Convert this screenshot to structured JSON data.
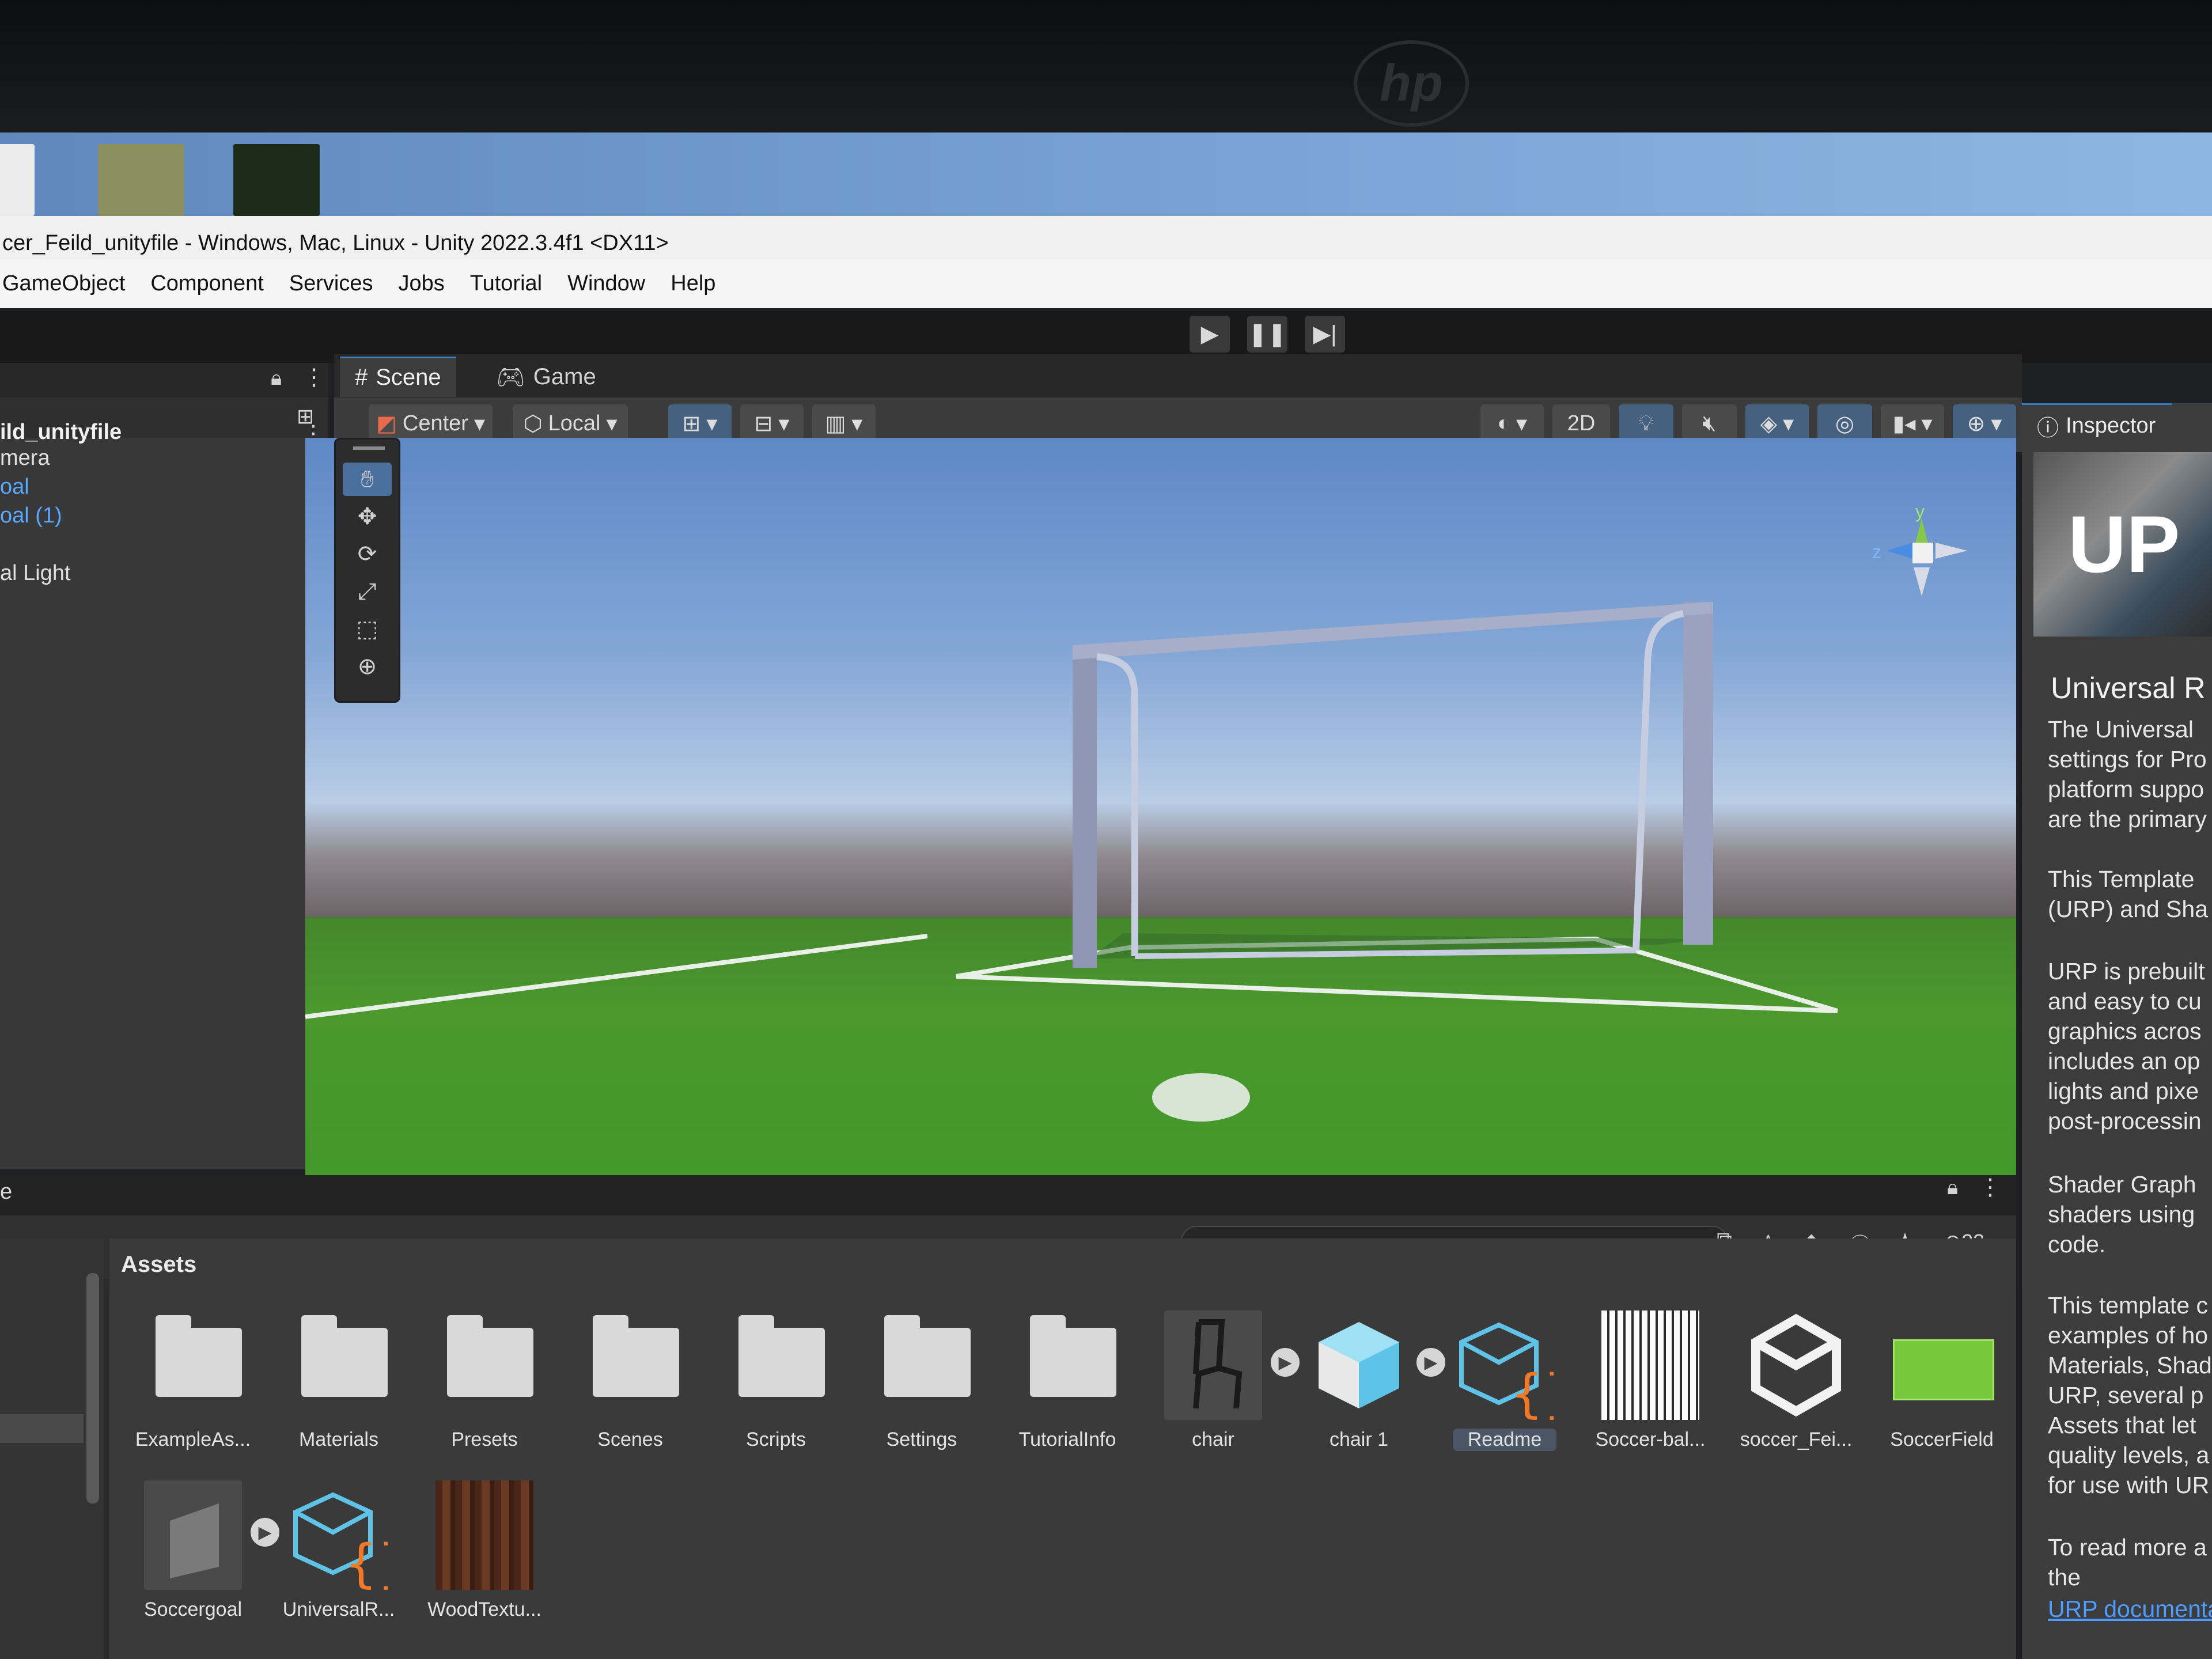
{
  "window": {
    "title": "cer_Feild_unityfile - Windows, Mac, Linux - Unity 2022.3.4f1 <DX11>"
  },
  "menu": [
    "GameObject",
    "Component",
    "Services",
    "Jobs",
    "Tutorial",
    "Window",
    "Help"
  ],
  "hierarchy": {
    "scene_name": "ild_unityfile",
    "items": [
      {
        "label": "mera",
        "color": "#e0e0e0"
      },
      {
        "label": "oal",
        "color": "#5aa7ff"
      },
      {
        "label": "oal (1)",
        "color": "#5aa7ff"
      },
      {
        "label": "al Light",
        "color": "#e0e0e0"
      }
    ]
  },
  "scene_tabs": [
    {
      "label": "Scene",
      "icon": "hash-icon",
      "active": true
    },
    {
      "label": "Game",
      "icon": "gamepad-icon",
      "active": false
    }
  ],
  "scene_toolbar": {
    "pivot": "Center",
    "space": "Local",
    "mode_2d": "2D"
  },
  "gizmo_axes": {
    "y": "y",
    "z": "z"
  },
  "inspector": {
    "tab_label": "Inspector",
    "banner_text": "UP",
    "title": "Universal R",
    "paragraphs": [
      "The Universal\nsettings for Pro\nplatform suppo\nare the primary",
      "This Template\n(URP) and Sha",
      "URP is prebuilt\nand easy to cu\ngraphics acros\nincludes an op\nlights and pixe\npost-processin",
      "Shader Graph\nshaders using\ncode.",
      "This template c\nexamples of ho\nMaterials, Shad\nURP, several p\nAssets that let\nquality levels, a\nfor use with UR",
      "To read more a\nthe"
    ],
    "link": "URP documenta"
  },
  "project": {
    "panel_label": "e",
    "assets_header": "Assets",
    "hidden_count": "23",
    "assets_row1": [
      {
        "label": "ExampleAs...",
        "kind": "folder"
      },
      {
        "label": "Materials",
        "kind": "folder"
      },
      {
        "label": "Presets",
        "kind": "folder"
      },
      {
        "label": "Scenes",
        "kind": "folder"
      },
      {
        "label": "Scripts",
        "kind": "folder"
      },
      {
        "label": "Settings",
        "kind": "folder"
      },
      {
        "label": "TutorialInfo",
        "kind": "folder"
      },
      {
        "label": "chair",
        "kind": "model"
      },
      {
        "label": "chair 1",
        "kind": "prefab"
      },
      {
        "label": "Readme",
        "kind": "script-asset"
      },
      {
        "label": "Soccer-bal...",
        "kind": "texture"
      },
      {
        "label": "soccer_Fei...",
        "kind": "unity-scene"
      },
      {
        "label": "SoccerField",
        "kind": "texture-green"
      }
    ],
    "assets_row2": [
      {
        "label": "Soccergoal",
        "kind": "model"
      },
      {
        "label": "UniversalR...",
        "kind": "script-asset"
      },
      {
        "label": "WoodTextu...",
        "kind": "texture-wood"
      }
    ]
  },
  "colors": {
    "editor_bg": "#383838",
    "accent_blue": "#3a79bb",
    "link_blue": "#4e9cff",
    "grass": "#4d9a30",
    "sky": "#7aa5d6"
  }
}
